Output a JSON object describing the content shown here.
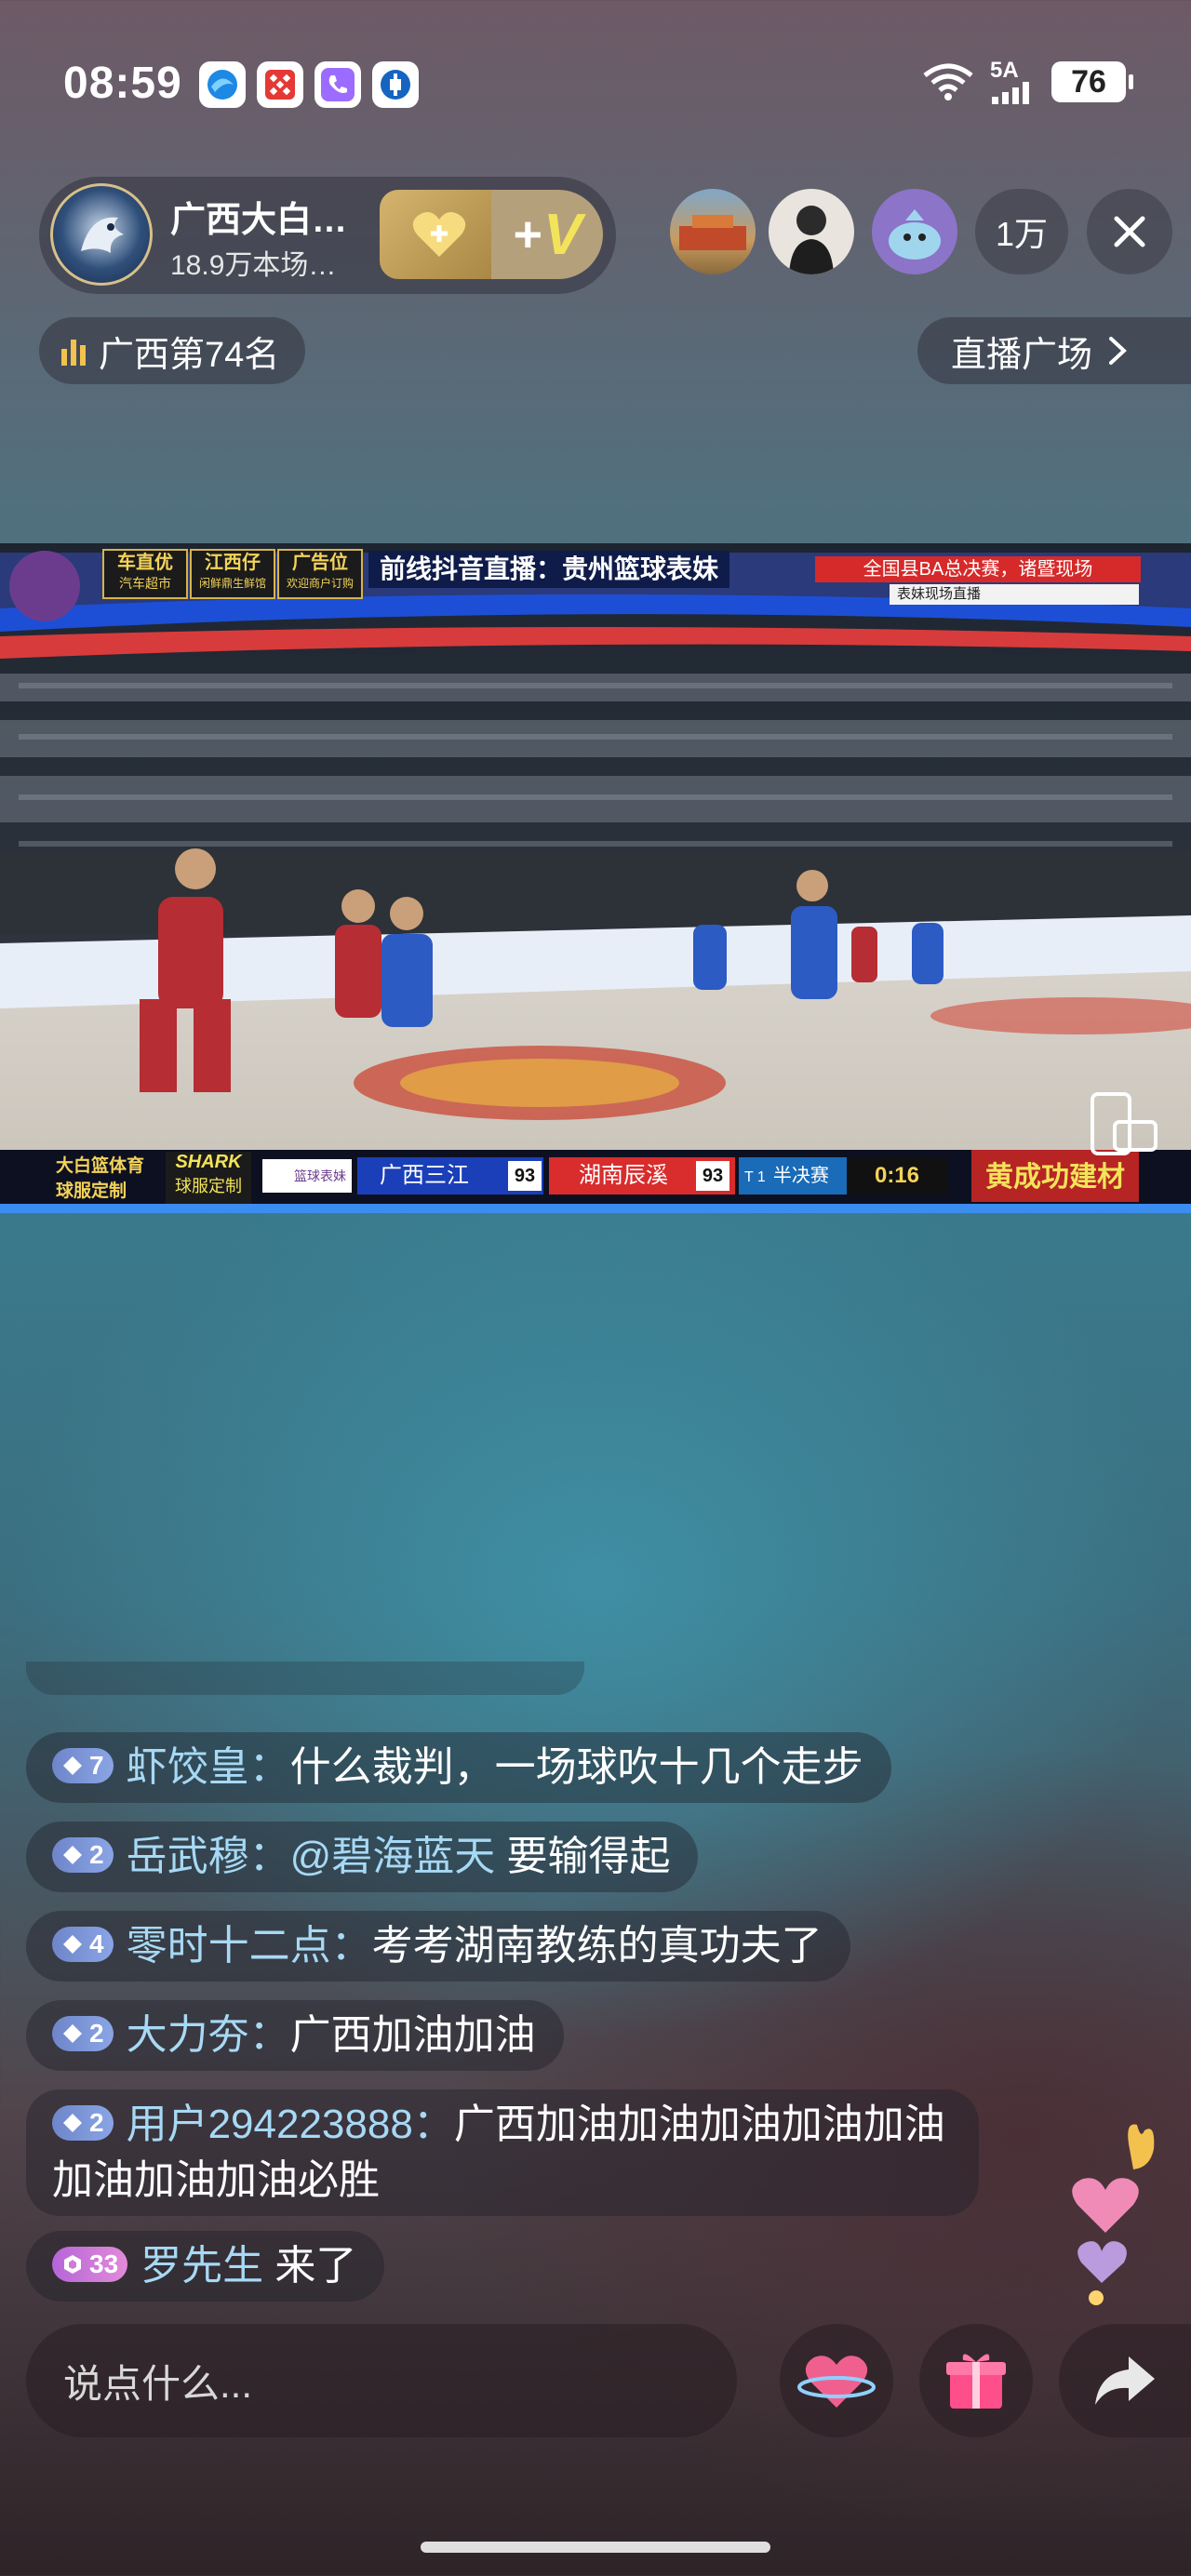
{
  "status_bar": {
    "time": "08:59",
    "network": "5A",
    "battery": "76"
  },
  "streamer": {
    "name": "广西大白…",
    "subtitle": "18.9万本场…"
  },
  "viewers": {
    "count": "1万"
  },
  "rank": {
    "label": "广西第74名"
  },
  "plaza": {
    "label": "直播广场"
  },
  "video": {
    "sponsor1_top": "车直优",
    "sponsor1_bottom": "汽车超市",
    "sponsor2_top": "江西仔",
    "sponsor2_bottom": "闲鲜鼎生鲜馆",
    "sponsor3_top": "广告位",
    "sponsor3_bottom": "欢迎商户订购",
    "headline": "前线抖音直播：贵州篮球表妹",
    "event_banner": "全国县BA总决赛，诸暨现场",
    "event_sub": "表妹现场直播",
    "bottom_left1": "大白篮体育",
    "bottom_left2": "球服定制",
    "shark_top": "SHARK",
    "shark_bottom": "球服定制",
    "small_tag": "篮球表妹",
    "team_home": "广西三江",
    "score_home": "93",
    "team_away": "湖南辰溪",
    "score_away": "93",
    "timeouts": "T 1",
    "stage": "半决赛",
    "clock": "0:16",
    "sponsor_right": "黄成功建材"
  },
  "chat": {
    "messages": [
      {
        "level": "7",
        "user": "虾饺皇",
        "sep": "：",
        "text": "什么裁判，一场球吹十几个走步"
      },
      {
        "level": "2",
        "user": "岳武穆",
        "sep": "：",
        "mention": "@碧海蓝天",
        "text": " 要输得起"
      },
      {
        "level": "4",
        "user": "零时十二点",
        "sep": "：",
        "text": "考考湖南教练的真功夫了"
      },
      {
        "level": "2",
        "user": "大力夯",
        "sep": "：",
        "text": "广西加油加油"
      },
      {
        "level": "2",
        "user": "用户294223888",
        "sep": "：",
        "text": "广西加油加油加油加油加油加油加油加油必胜"
      },
      {
        "level": "33",
        "user": "罗先生",
        "sep": " ",
        "text": "来了"
      }
    ]
  },
  "bottom": {
    "input_placeholder": "说点什么..."
  },
  "colors": {
    "username": "#a7d9f5",
    "level_badge": "#7d95d8",
    "home_team": "#1a3fb8",
    "away_team": "#d92c2c"
  }
}
